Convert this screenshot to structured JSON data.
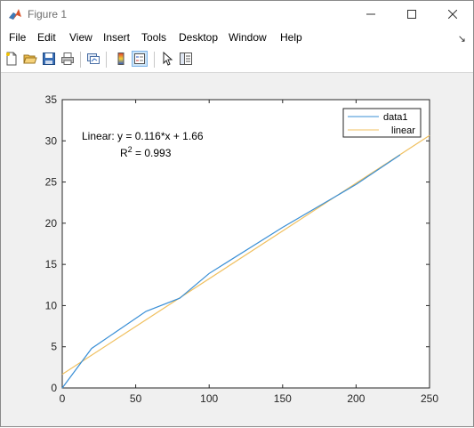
{
  "window": {
    "title": "Figure 1"
  },
  "menu": {
    "items": [
      "File",
      "Edit",
      "View",
      "Insert",
      "Tools",
      "Desktop",
      "Window",
      "Help"
    ]
  },
  "toolbar": {
    "icons": [
      "new-figure-icon",
      "open-file-icon",
      "save-icon",
      "print-icon",
      "link-icon",
      "colorbar-icon",
      "legend-icon",
      "pointer-icon",
      "property-editor-icon"
    ]
  },
  "colors": {
    "series1": "#3a8fd6",
    "fit": "#f0c060"
  },
  "chart_data": {
    "type": "line",
    "xlim": [
      0,
      250
    ],
    "ylim": [
      0,
      35
    ],
    "xticks": [
      0,
      50,
      100,
      150,
      200,
      250
    ],
    "yticks": [
      0,
      5,
      10,
      15,
      20,
      25,
      30,
      35
    ],
    "grid": false,
    "legend_position": "top-right",
    "series": [
      {
        "name": "data1",
        "x": [
          0,
          20,
          57,
          80,
          100,
          150,
          200,
          230
        ],
        "y": [
          0,
          4.8,
          9.3,
          10.9,
          13.9,
          19.5,
          24.7,
          28.3
        ]
      },
      {
        "name": "linear",
        "x": [
          0,
          250
        ],
        "y": [
          1.66,
          30.66
        ]
      }
    ],
    "annotation": {
      "equation": "Linear:  y = 0.116*x + 1.66",
      "r2_label": "R",
      "r2_sup": "2",
      "r2_value": " = 0.993"
    }
  }
}
